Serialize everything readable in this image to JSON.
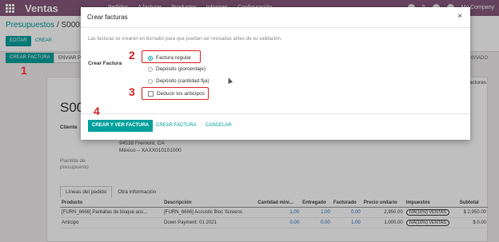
{
  "navbar": {
    "app_name": "Ventas",
    "menu": [
      "Pedidos",
      "A facturar",
      "Productos",
      "Informes",
      "Configuración"
    ],
    "user": "My Company",
    "badge": "5"
  },
  "control_panel": {
    "breadcrumb_parent": "Presupuestos",
    "breadcrumb_sep": "/",
    "breadcrumb_current": "S00023",
    "edit_label": "EDITAR",
    "create_label": "CREAR",
    "create_invoice_label": "CREAR FACTURA",
    "send_label": "ENVIAR POR",
    "status_right": "ENVIADO",
    "smart_button": "Facturas"
  },
  "form": {
    "so_name": "S00",
    "customer_label": "Cliente",
    "address_line1": "94538 Fremont, CA",
    "address_line2": "México – XAXX010101000",
    "template_label_1": "Plantilla de",
    "template_label_2": "presupuesto"
  },
  "tabs": [
    "Líneas del pedido",
    "Otra información"
  ],
  "lines": {
    "headers": [
      "Producto",
      "Descripción",
      "Cantidad mini...",
      "Entregado",
      "Facturado",
      "Precio unitario",
      "Impuestos",
      "Subtotal"
    ],
    "rows": [
      [
        "[FURN_6666] Pantallas de bloque acú...",
        "[FURN_6666] Acoustic Bloc Screens",
        "1.00",
        "1.00",
        "0.00",
        "2,950.00",
        "IVA(16%) VENTAS",
        "$ 2,950.00"
      ],
      [
        "Anticipo",
        "Down Payment: 01 2021",
        "0.00",
        "0.00",
        "1.00",
        "1,000.00",
        "IVA(16%) VENTAS",
        "$ 0.00"
      ]
    ]
  },
  "modal": {
    "title": "Crear facturas",
    "close": "×",
    "note": "Las facturas se crearán en borrador para que puedan ser revisadas antes de su validación.",
    "field_label": "Crear Factura",
    "options": [
      "Factura regular",
      "Depósito (porcentaje)",
      "Depósito (cantidad fija)"
    ],
    "selected_option": "Factura regular",
    "deduct_label": "Deducir los anticipos",
    "deduct_checked": false,
    "btn_create_view": "CREAR Y VER FACTURA",
    "btn_create": "CREAR FACTURA",
    "btn_cancel": "CANCELAR"
  },
  "annotations": {
    "step1": "1",
    "step2": "2",
    "step3": "3",
    "step4": "4"
  },
  "colors": {
    "brand": "#875a7b",
    "accent": "#00a09d",
    "highlight": "#d6262a"
  }
}
